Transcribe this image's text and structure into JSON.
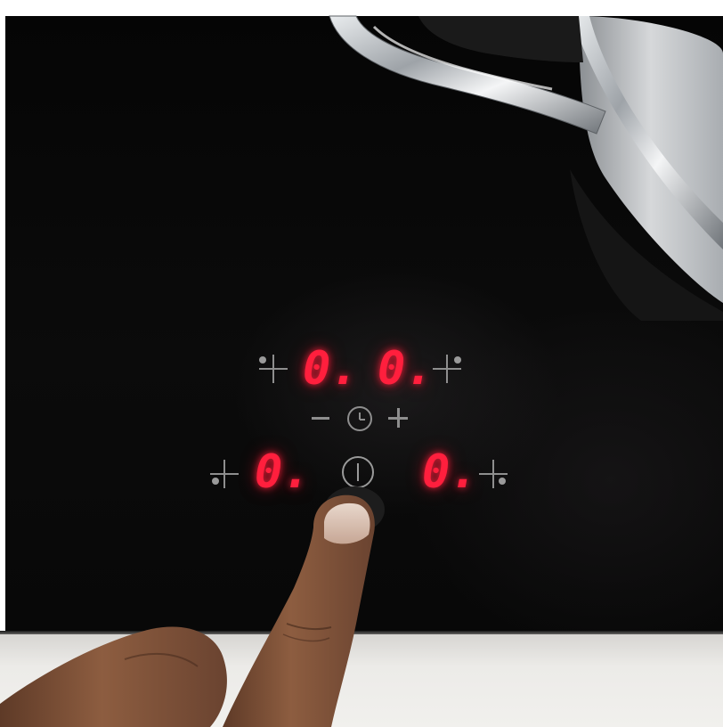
{
  "scene": {
    "object": "induction-cooktop-touch-controls",
    "cooking_zones": [
      {
        "zone": "rear-left",
        "level": "0."
      },
      {
        "zone": "rear-right",
        "level": "0."
      },
      {
        "zone": "front-left",
        "level": "0."
      },
      {
        "zone": "front-right",
        "level": "0."
      }
    ],
    "timer": {
      "minus_icon": "minus-icon",
      "clock_icon": "timer-clock-icon",
      "plus_icon": "plus-icon"
    },
    "power_icon": "power-icon",
    "colors": {
      "glass": "#070707",
      "led_digits": "#ff1f3d",
      "touch_symbols": "#8e8e8e",
      "countertop": "#ecebe8",
      "pot_steel": "#b9bcbf",
      "skin": "#8a5a3e"
    }
  }
}
